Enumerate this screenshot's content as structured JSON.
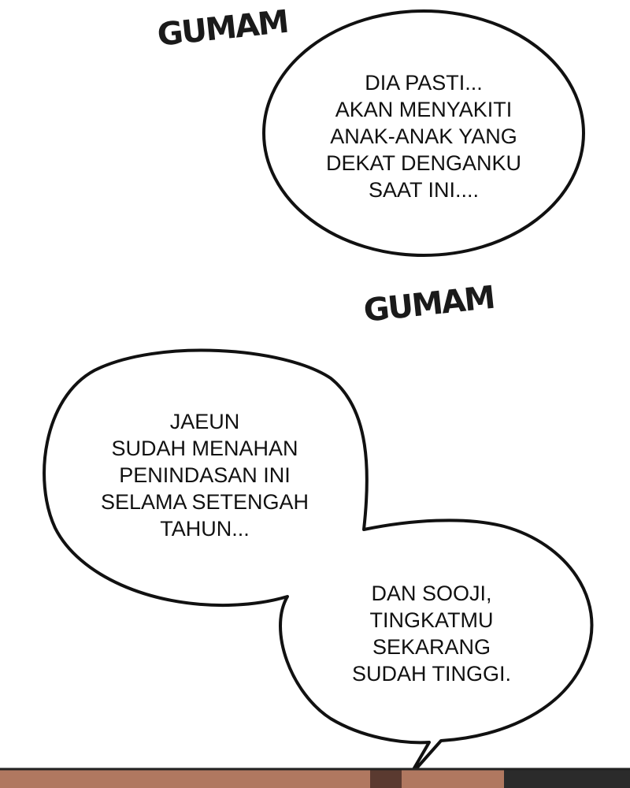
{
  "sound_effects": {
    "top": "GUMAM",
    "middle": "GUMAM"
  },
  "bubbles": {
    "top_right": "DIA PASTI...\nAKAN MENYAKITI\nANAK-ANAK YANG\nDEKAT DENGANKU\nSAAT INI....",
    "left": "JAEUN\nSUDAH MENAHAN\nPENINDASAN INI\nSELAMA SETENGAH\nTAHUN...",
    "bottom_right": "DAN SOOJI,\nTINGKATMU\nSEKARANG\nSUDAH TINGGI."
  },
  "colors": {
    "ink": "#111111",
    "background": "#ffffff",
    "strip": "#b07860"
  }
}
